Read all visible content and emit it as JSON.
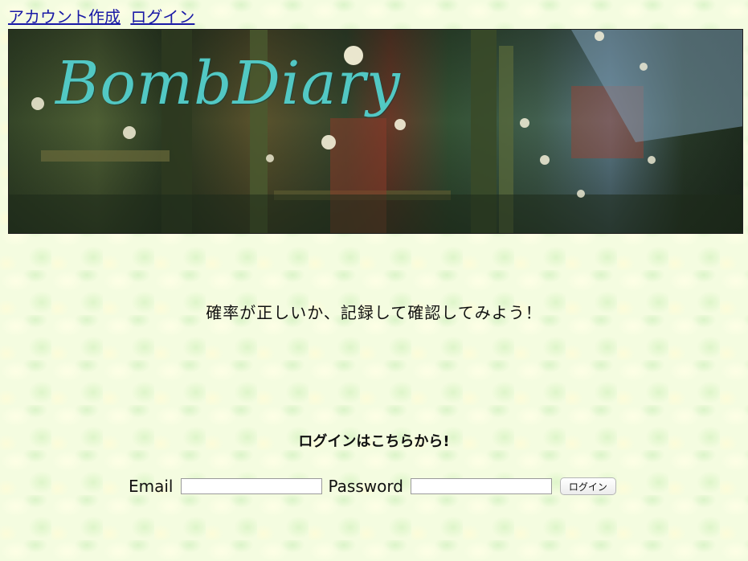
{
  "nav": {
    "create_account": "アカウント作成",
    "login": "ログイン"
  },
  "banner": {
    "logo_text": "BombDiary"
  },
  "tagline": "確率が正しいか、記録して確認してみよう！",
  "login_section": {
    "heading": "ログインはこちらから!",
    "email_label": "Email",
    "email_value": "",
    "password_label": "Password",
    "password_value": "",
    "submit_label": "ログイン"
  },
  "colors": {
    "link": "#1a1aa6",
    "logo": "#52c8c4",
    "background": "#f4fce0"
  }
}
